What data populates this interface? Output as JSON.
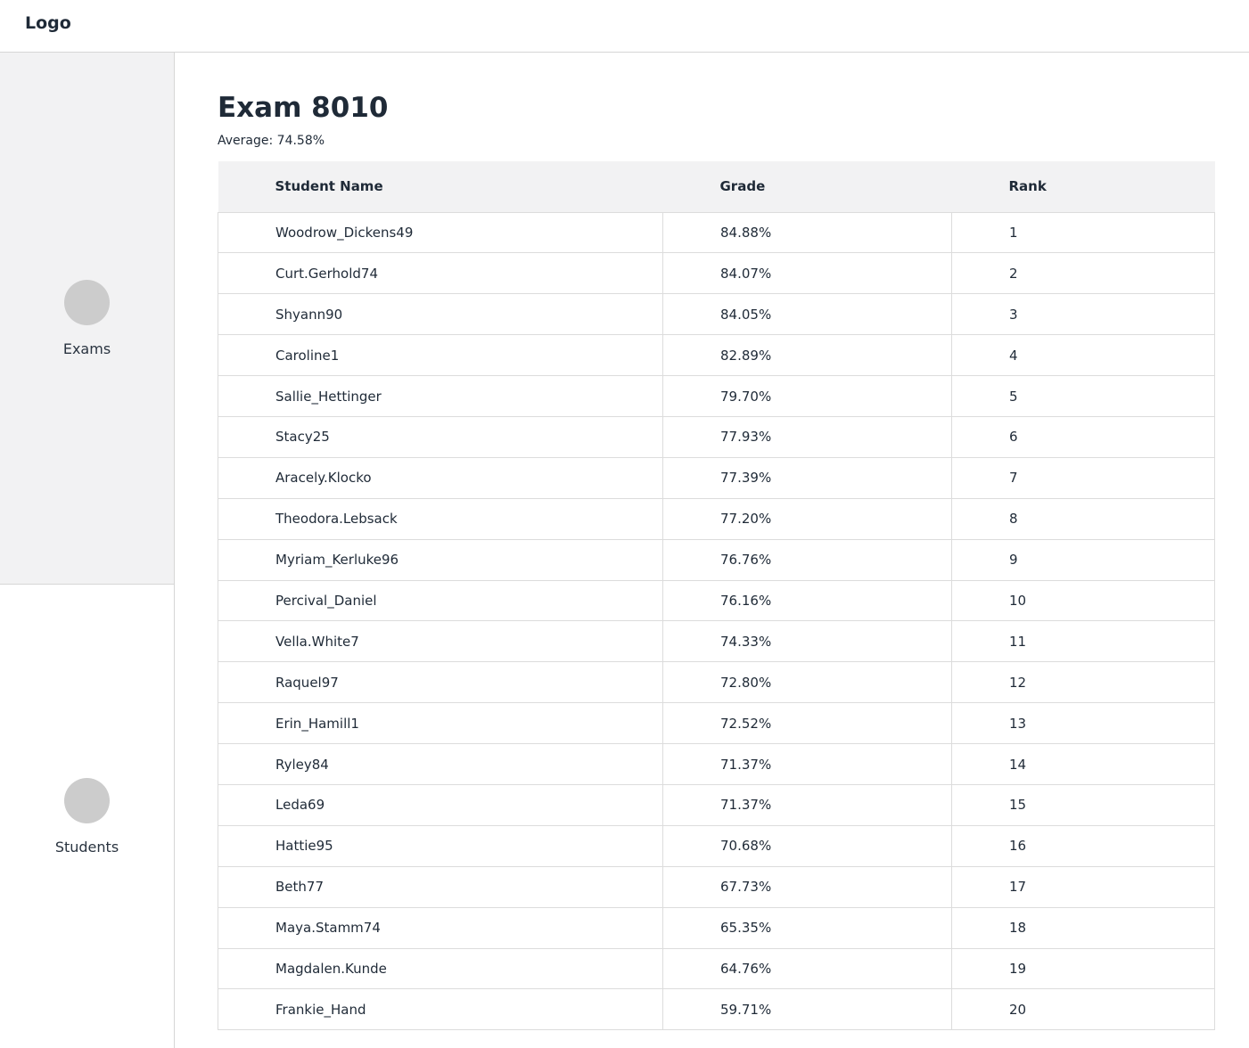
{
  "header": {
    "logo": "Logo"
  },
  "sidebar": {
    "items": [
      {
        "label": "Exams",
        "icon": "circle-icon"
      },
      {
        "label": "Students",
        "icon": "circle-icon"
      }
    ]
  },
  "main": {
    "title": "Exam 8010",
    "average": "Average: 74.58%",
    "table": {
      "columns": [
        "Student Name",
        "Grade",
        "Rank"
      ],
      "rows": [
        [
          "Woodrow_Dickens49",
          "84.88%",
          "1"
        ],
        [
          "Curt.Gerhold74",
          "84.07%",
          "2"
        ],
        [
          "Shyann90",
          "84.05%",
          "3"
        ],
        [
          "Caroline1",
          "82.89%",
          "4"
        ],
        [
          "Sallie_Hettinger",
          "79.70%",
          "5"
        ],
        [
          "Stacy25",
          "77.93%",
          "6"
        ],
        [
          "Aracely.Klocko",
          "77.39%",
          "7"
        ],
        [
          "Theodora.Lebsack",
          "77.20%",
          "8"
        ],
        [
          "Myriam_Kerluke96",
          "76.76%",
          "9"
        ],
        [
          "Percival_Daniel",
          "76.16%",
          "10"
        ],
        [
          "Vella.White7",
          "74.33%",
          "11"
        ],
        [
          "Raquel97",
          "72.80%",
          "12"
        ],
        [
          "Erin_Hamill1",
          "72.52%",
          "13"
        ],
        [
          "Ryley84",
          "71.37%",
          "14"
        ],
        [
          "Leda69",
          "71.37%",
          "15"
        ],
        [
          "Hattie95",
          "70.68%",
          "16"
        ],
        [
          "Beth77",
          "67.73%",
          "17"
        ],
        [
          "Maya.Stamm74",
          "65.35%",
          "18"
        ],
        [
          "Magdalen.Kunde",
          "64.76%",
          "19"
        ],
        [
          "Frankie_Hand",
          "59.71%",
          "20"
        ]
      ]
    }
  }
}
